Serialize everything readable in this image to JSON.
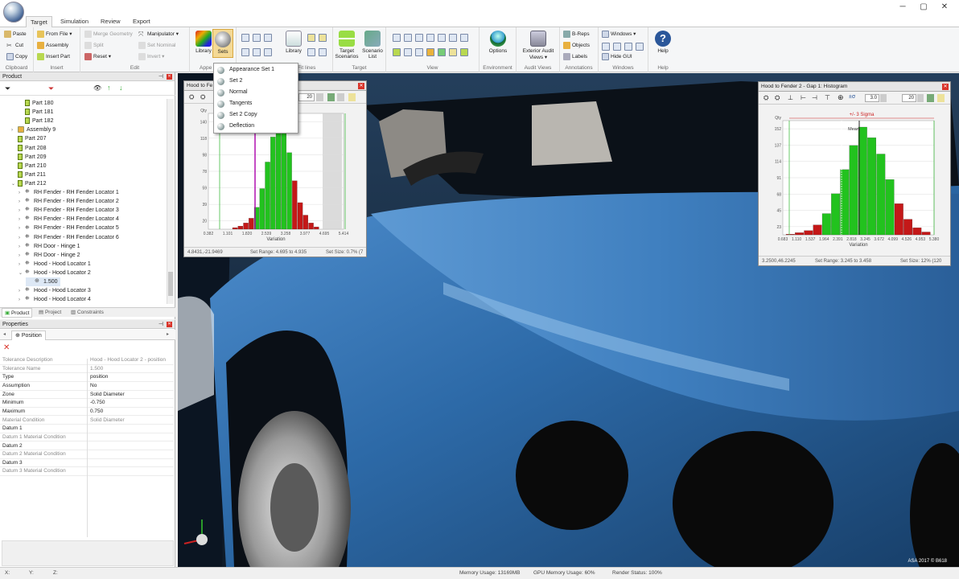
{
  "window": {
    "minimize": "─",
    "maximize": "▢",
    "close": "✕"
  },
  "tabs": [
    "Target",
    "Simulation",
    "Review",
    "Export"
  ],
  "ribbon": {
    "clipboard": {
      "label": "Clipboard",
      "paste": "Paste",
      "cut": "Cut",
      "copy": "Copy"
    },
    "insert": {
      "label": "Insert",
      "from_file": "From File",
      "assembly": "Assembly",
      "insert_part": "Insert Part"
    },
    "edit": {
      "label": "Edit",
      "merge_geometry": "Merge Geometry",
      "split": "Split",
      "reset": "Reset",
      "manipulator": "Manipulator",
      "set_nominal": "Set Nominal",
      "invert": "Invert"
    },
    "appearance": {
      "label": "Appe",
      "library": "Library",
      "sets": "Sets"
    },
    "fit_lines": {
      "label": "Fit lines",
      "library": "Library"
    },
    "target": {
      "label": "Target",
      "target_scenarios": "Target Scenarios",
      "scenario_list": "Scenario List"
    },
    "view": {
      "label": "View"
    },
    "environment": {
      "label": "Environment",
      "options": "Options"
    },
    "audit_views": {
      "label": "Audit Views",
      "exterior": "Exterior Audit Views"
    },
    "annotations": {
      "label": "Annotations",
      "breps": "B-Reps",
      "objects": "Objects",
      "labels": "Labels"
    },
    "windows": {
      "label": "Windows",
      "windows": "Windows",
      "hide_gui": "Hide GUI"
    },
    "help": {
      "label": "Help",
      "help": "Help"
    }
  },
  "sets_menu": [
    "Appearance Set 1",
    "Set 2",
    "Normal",
    "Tangents",
    "Set 2 Copy",
    "Deflection"
  ],
  "product_panel": {
    "title": "Product",
    "tree": [
      {
        "label": "Part 180",
        "type": "part",
        "indent": 1
      },
      {
        "label": "Part 181",
        "type": "part",
        "indent": 1
      },
      {
        "label": "Part 182",
        "type": "part",
        "indent": 1
      },
      {
        "label": "Assembly 9",
        "type": "asm",
        "indent": 0
      },
      {
        "label": "Part 207",
        "type": "part",
        "indent": 0
      },
      {
        "label": "Part 208",
        "type": "part",
        "indent": 0
      },
      {
        "label": "Part 209",
        "type": "part",
        "indent": 0
      },
      {
        "label": "Part 210",
        "type": "part",
        "indent": 0
      },
      {
        "label": "Part 211",
        "type": "part",
        "indent": 0
      },
      {
        "label": "Part 212",
        "type": "part",
        "indent": 0
      },
      {
        "label": "RH Fender - RH Fender Locator 1",
        "type": "tol",
        "indent": 1
      },
      {
        "label": "RH Fender - RH Fender Locator 2",
        "type": "tol",
        "indent": 1
      },
      {
        "label": "RH Fender - RH Fender Locator 3",
        "type": "tol",
        "indent": 1
      },
      {
        "label": "RH Fender - RH Fender Locator 4",
        "type": "tol",
        "indent": 1
      },
      {
        "label": "RH Fender - RH Fender Locator 5",
        "type": "tol",
        "indent": 1
      },
      {
        "label": "RH Fender - RH Fender Locator 6",
        "type": "tol",
        "indent": 1
      },
      {
        "label": "RH Door - Hinge 1",
        "type": "tol",
        "indent": 1
      },
      {
        "label": "RH Door - Hinge 2",
        "type": "tol",
        "indent": 1
      },
      {
        "label": "Hood - Hood Locator 1",
        "type": "tol",
        "indent": 1
      },
      {
        "label": "Hood - Hood Locator 2",
        "type": "tol",
        "indent": 1
      },
      {
        "label": "1.500",
        "type": "val",
        "indent": 2
      },
      {
        "label": "Hood - Hood Locator 3",
        "type": "tol",
        "indent": 1
      },
      {
        "label": "Hood - Hood Locator 4",
        "type": "tol",
        "indent": 1
      }
    ],
    "tabs": [
      "Product",
      "Project",
      "Constraints"
    ]
  },
  "properties": {
    "title": "Properties",
    "tab": "Position",
    "rows": [
      {
        "k": "Tolerance Description",
        "v": "Hood - Hood Locator 2 - position",
        "muted": true
      },
      {
        "k": "Tolerance Name",
        "v": "1.500",
        "muted": true
      },
      {
        "k": "Type",
        "v": "position",
        "muted": false
      },
      {
        "k": "Assumption",
        "v": "No",
        "muted": false
      },
      {
        "k": "Zone",
        "v": "Solid Diameter",
        "muted": false
      },
      {
        "k": "Minimum",
        "v": "-0.750",
        "muted": false
      },
      {
        "k": "Maximum",
        "v": "0.750",
        "muted": false
      },
      {
        "k": "Material Condition",
        "v": "Solid Diameter",
        "muted": true
      },
      {
        "k": "Datum 1",
        "v": "",
        "muted": false
      },
      {
        "k": "Datum 1 Material Condition",
        "v": "",
        "muted": true
      },
      {
        "k": "Datum 2",
        "v": "",
        "muted": false
      },
      {
        "k": "Datum 2 Material Condition",
        "v": "",
        "muted": true
      },
      {
        "k": "Datum 3",
        "v": "",
        "muted": false
      },
      {
        "k": "Datum 3 Material Condition",
        "v": "",
        "muted": true
      }
    ]
  },
  "hist_left": {
    "title": "Hood to Fe",
    "bins": "20",
    "ylabel": "Qty",
    "yticks": [
      "140",
      "118",
      "98",
      "78",
      "59",
      "39",
      "20"
    ],
    "xticks": [
      "0.382",
      "1.101",
      "1.820",
      "2.539",
      "3.258",
      "3.977",
      "4.695",
      "5.414"
    ],
    "xlabel": "Variation",
    "coords": "4.8431,-21.9469",
    "set_range": "Set Range: 4.695 to 4.935",
    "set_size": "Set Size: 0.7% (7"
  },
  "hist_right": {
    "title": "Hood to Fender 2 - Gap 1: Histogram",
    "sigma": "3.0",
    "bins": "20",
    "ylabel": "Qty",
    "yticks": [
      "152",
      "137",
      "114",
      "91",
      "68",
      "45",
      "23"
    ],
    "xticks": [
      "0.683",
      "1.110",
      "1.537",
      "1.964",
      "2.391",
      "2.818",
      "3.245",
      "3.672",
      "4.099",
      "4.526",
      "4.953",
      "5.380"
    ],
    "xlabel": "Variation",
    "sigma_label": "+/- 3 Sigma",
    "mean_label": "Mean",
    "coords": "3.2500,46.2245",
    "set_range": "Set Range: 3.245 to 3.458",
    "set_size": "Set Size: 12% (120"
  },
  "watermark": "ASA 2017 © B618",
  "status": {
    "x": "X:",
    "y": "Y:",
    "z": "Z:",
    "memory": "Memory Usage: 13169MB",
    "gpu": "GPU Memory Usage: 60%",
    "render": "Render Status: 100%"
  },
  "colors": {
    "accent": "#2b579a",
    "in_spec": "#22c21e",
    "out_spec": "#c41818",
    "car_blue": "#2f6faf"
  }
}
